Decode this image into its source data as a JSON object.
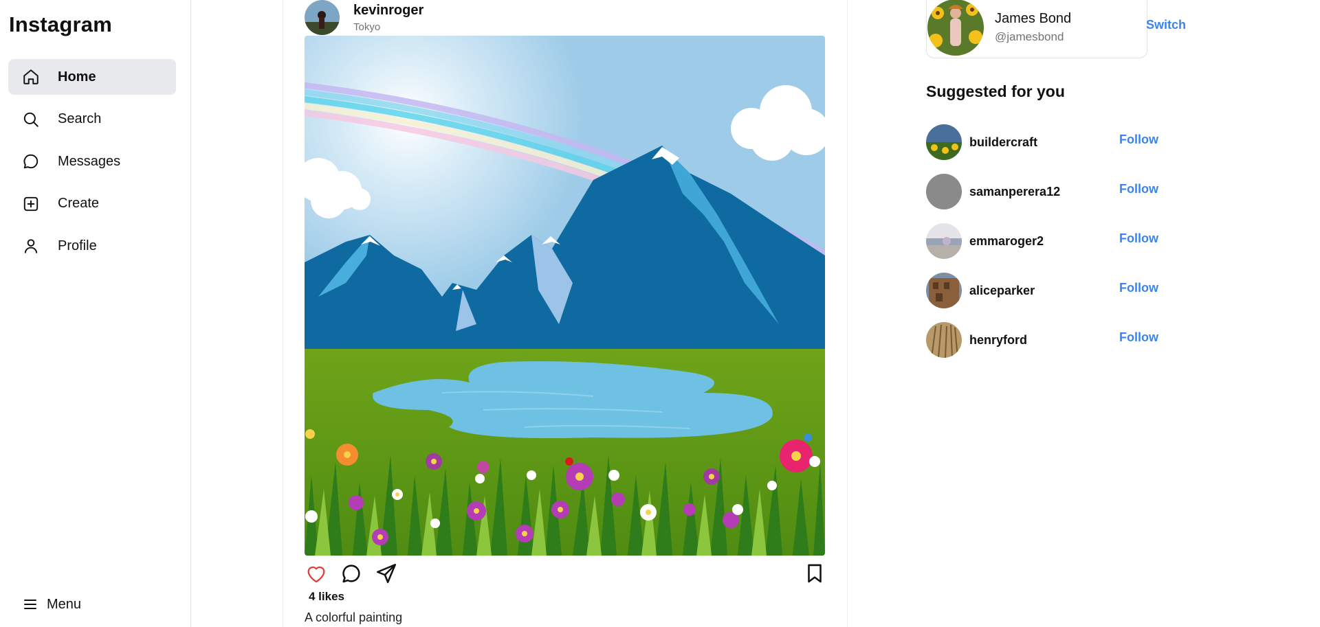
{
  "app": {
    "logo": "Instagram"
  },
  "sidebar": {
    "items": [
      {
        "label": "Home",
        "icon": "home-icon",
        "active": true
      },
      {
        "label": "Search",
        "icon": "search-icon",
        "active": false
      },
      {
        "label": "Messages",
        "icon": "message-icon",
        "active": false
      },
      {
        "label": "Create",
        "icon": "plus-square-icon",
        "active": false
      },
      {
        "label": "Profile",
        "icon": "user-icon",
        "active": false
      }
    ],
    "menu_label": "Menu"
  },
  "post": {
    "username": "kevinroger",
    "location": "Tokyo",
    "likes": "4 likes",
    "caption": "A colorful painting",
    "liked": false
  },
  "account": {
    "name": "James Bond",
    "handle": "@jamesbond",
    "switch_label": "Switch"
  },
  "suggestions": {
    "title": "Suggested for you",
    "follow_label": "Follow",
    "users": [
      {
        "username": "buildercraft"
      },
      {
        "username": "samanperera12"
      },
      {
        "username": "emmaroger2"
      },
      {
        "username": "aliceparker"
      },
      {
        "username": "henryford"
      }
    ]
  },
  "colors": {
    "accent": "#3a84f0",
    "like": "#e5383b",
    "active_nav_bg": "#e8e9ec"
  }
}
